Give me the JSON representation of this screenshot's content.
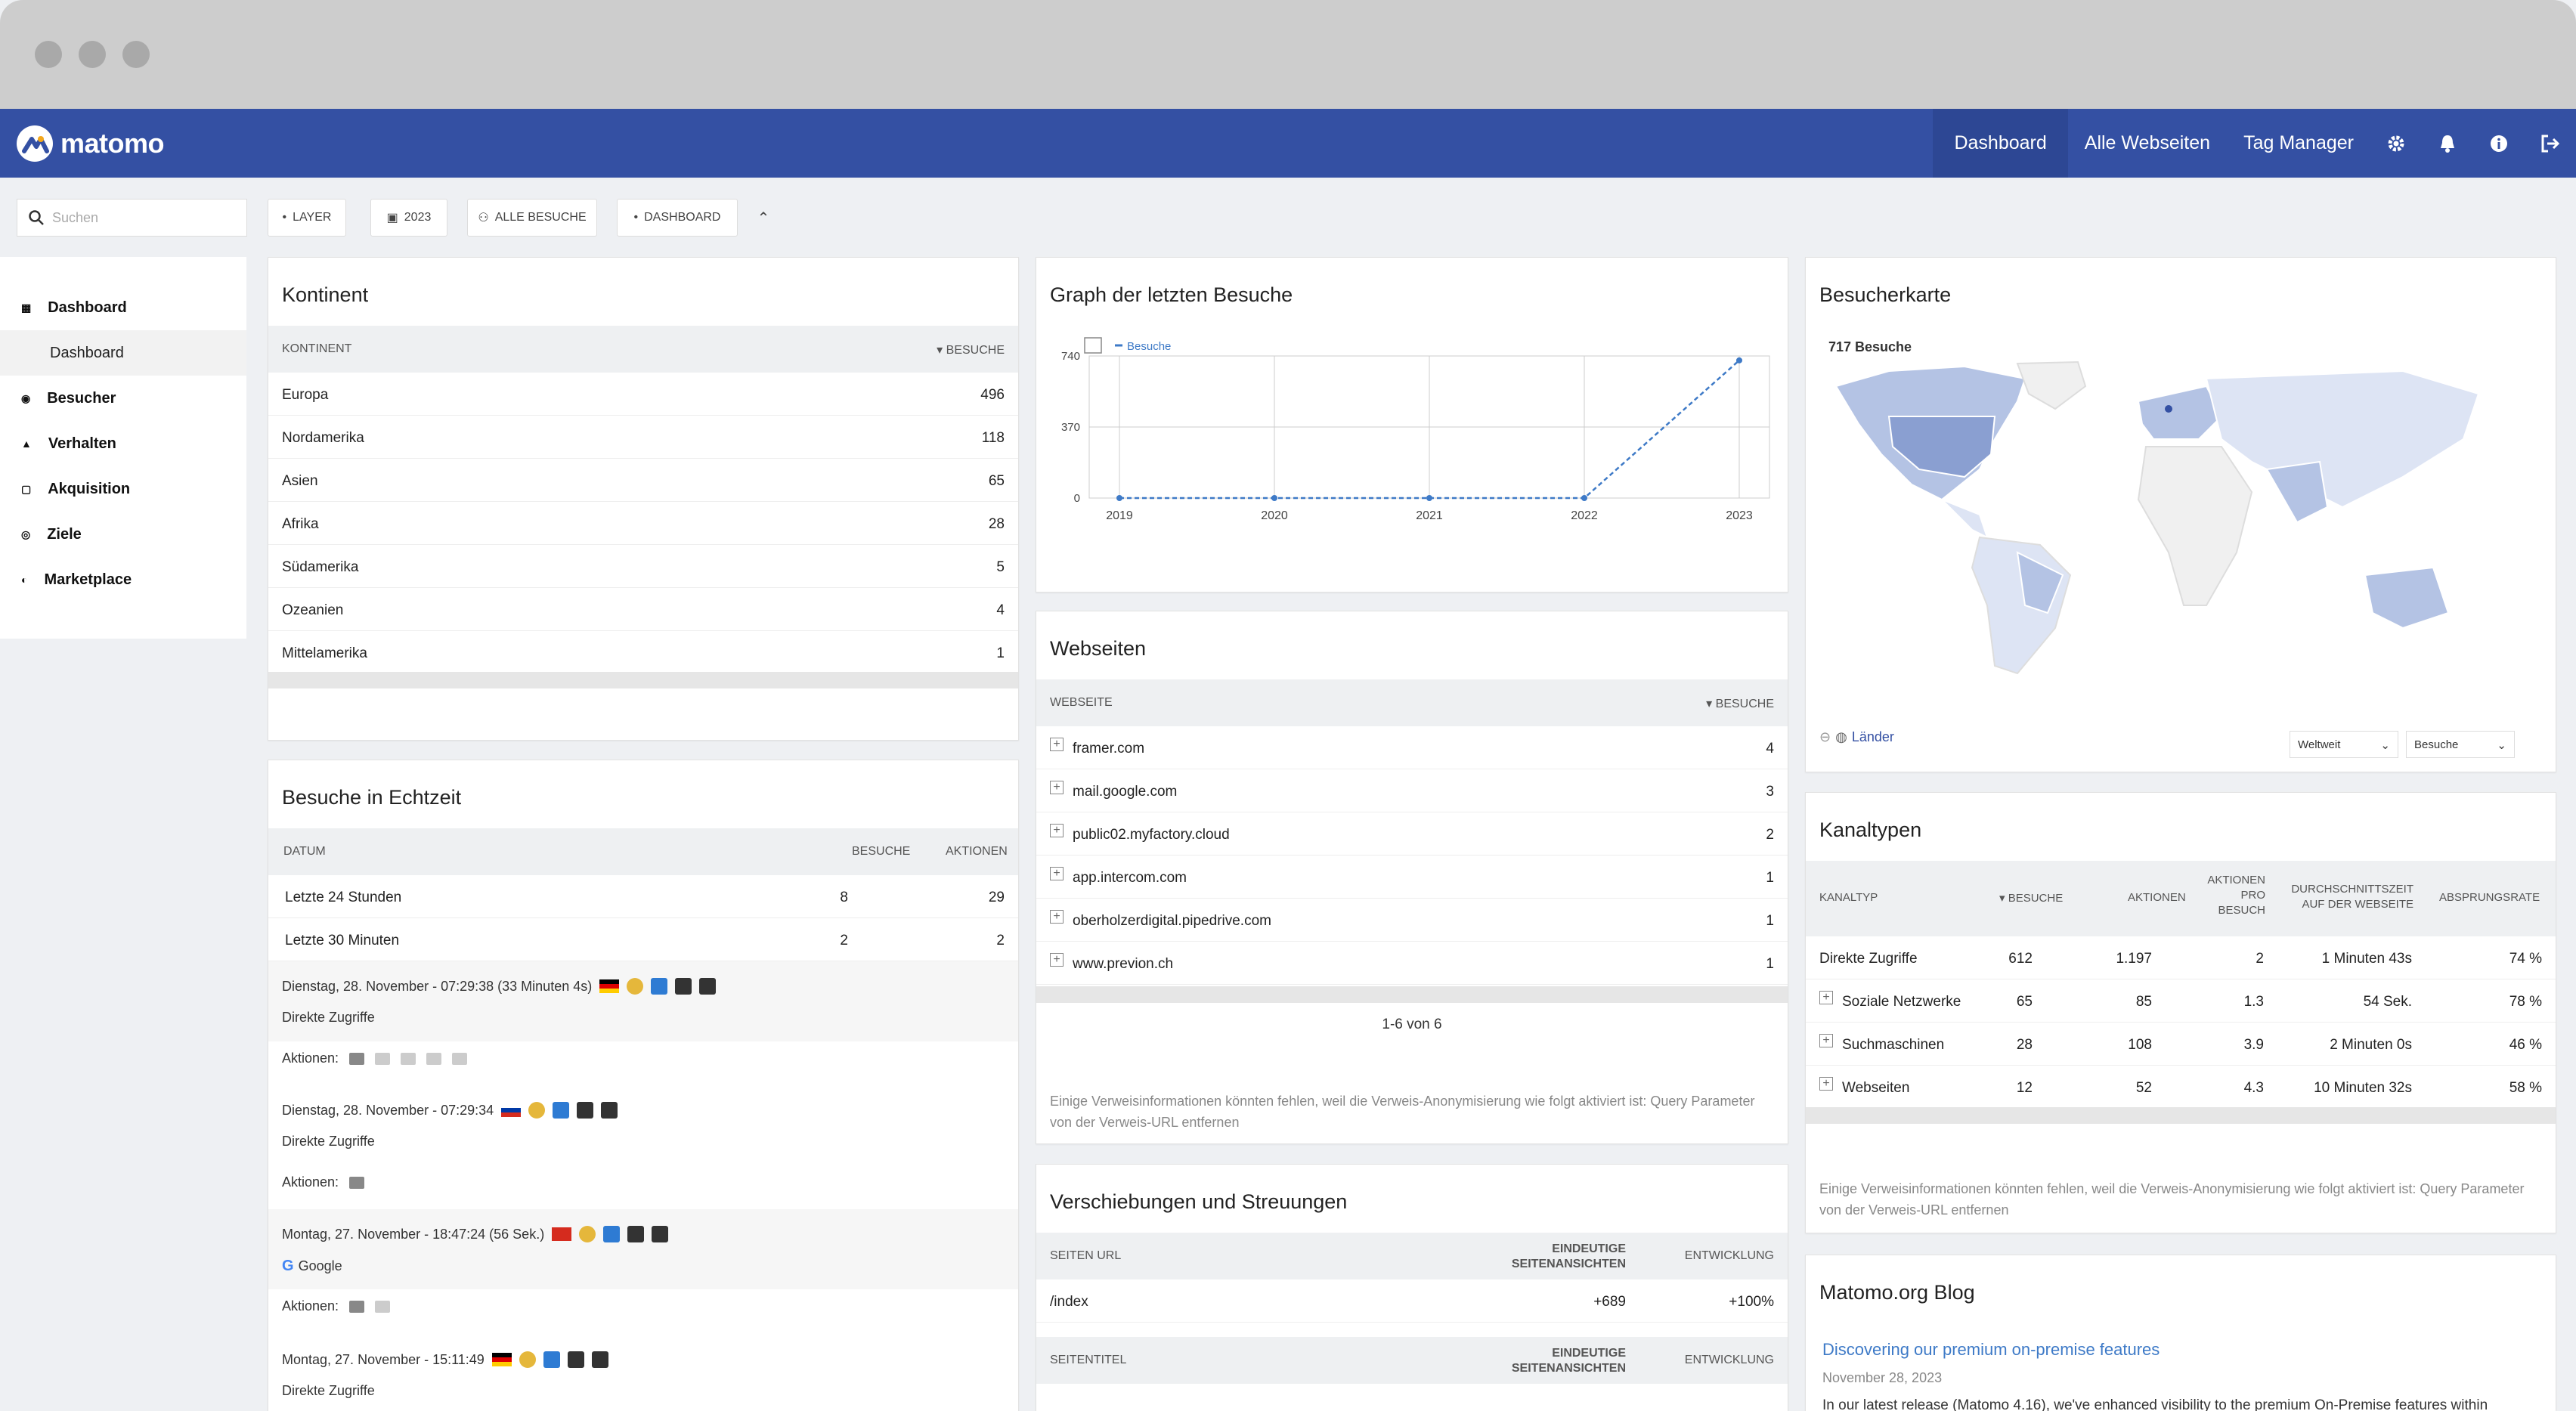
{
  "app": {
    "name": "matomo"
  },
  "nav": {
    "dashboard": "Dashboard",
    "all_sites": "Alle Webseiten",
    "tag_manager": "Tag Manager"
  },
  "toolbar": {
    "search_placeholder": "Suchen",
    "layer": "LAYER",
    "year": "2023",
    "segment": "ALLE BESUCHE",
    "dashboard": "DASHBOARD"
  },
  "sidebar": {
    "items": [
      {
        "label": "Dashboard",
        "icon": "grid-icon"
      },
      {
        "label": "Dashboard",
        "sub": true
      },
      {
        "label": "Besucher",
        "icon": "binoculars-icon"
      },
      {
        "label": "Verhalten",
        "icon": "bell-icon"
      },
      {
        "label": "Akquisition",
        "icon": "calendar-icon"
      },
      {
        "label": "Ziele",
        "icon": "target-icon"
      },
      {
        "label": "Marketplace",
        "icon": "headphones-icon"
      }
    ]
  },
  "continent": {
    "title": "Kontinent",
    "col1": "KONTINENT",
    "col2": "BESUCHE",
    "rows": [
      {
        "name": "Europa",
        "value": "496"
      },
      {
        "name": "Nordamerika",
        "value": "118"
      },
      {
        "name": "Asien",
        "value": "65"
      },
      {
        "name": "Afrika",
        "value": "28"
      },
      {
        "name": "Südamerika",
        "value": "5"
      },
      {
        "name": "Ozeanien",
        "value": "4"
      },
      {
        "name": "Mittelamerika",
        "value": "1"
      }
    ]
  },
  "realtime": {
    "title": "Besuche in Echtzeit",
    "col1": "DATUM",
    "col2": "BESUCHE",
    "col3": "AKTIONEN",
    "rows": [
      {
        "label": "Letzte 24 Stunden",
        "visits": "8",
        "actions": "29"
      },
      {
        "label": "Letzte 30 Minuten",
        "visits": "2",
        "actions": "2"
      }
    ],
    "actions_label": "Aktionen:",
    "visits": [
      {
        "time": "Dienstag, 28. November - 07:29:38 (33 Minuten 4s)",
        "source": "Direkte Zugriffe"
      },
      {
        "time": "Dienstag, 28. November - 07:29:34",
        "source": "Direkte Zugriffe"
      },
      {
        "time": "Montag, 27. November - 18:47:24 (56 Sek.)",
        "source": "Google"
      },
      {
        "time": "Montag, 27. November - 15:11:49",
        "source": "Direkte Zugriffe"
      }
    ]
  },
  "graph": {
    "title": "Graph der letzten Besuche"
  },
  "chart_data": {
    "type": "line",
    "categories": [
      "2019",
      "2020",
      "2021",
      "2022",
      "2023"
    ],
    "series": [
      {
        "name": "Besuche",
        "values": [
          0,
          0,
          0,
          0,
          717
        ]
      }
    ],
    "yticks": [
      "0",
      "370",
      "740"
    ],
    "ylim": [
      0,
      740
    ],
    "grid": true,
    "legend": "top-left"
  },
  "websites": {
    "title": "Webseiten",
    "col1": "WEBSEITE",
    "col2": "BESUCHE",
    "rows": [
      {
        "name": "framer.com",
        "value": "4"
      },
      {
        "name": "mail.google.com",
        "value": "3"
      },
      {
        "name": "public02.myfactory.cloud",
        "value": "2"
      },
      {
        "name": "app.intercom.com",
        "value": "1"
      },
      {
        "name": "oberholzerdigital.pipedrive.com",
        "value": "1"
      },
      {
        "name": "www.previon.ch",
        "value": "1"
      }
    ],
    "pagination": "1-6 von 6",
    "note": "Einige Verweisinformationen könnten fehlen, weil die Verweis-Anonymisierung wie folgt aktiviert ist: Query Parameter von der Verweis-URL entfernen"
  },
  "movers": {
    "title": "Verschiebungen und Streuungen",
    "col1": "SEITEN URL",
    "col2a": "EINDEUTIGE",
    "col2b": "SEITENANSICHTEN",
    "col3": "ENTWICKLUNG",
    "row": {
      "url": "/index",
      "views": "+689",
      "dev": "+100%"
    },
    "col1b": "SEITENTITEL"
  },
  "map": {
    "title": "Besucherkarte",
    "total": "717 Besuche",
    "countries": "Länder",
    "region": "Weltweit",
    "metric": "Besuche"
  },
  "channels": {
    "title": "Kanaltypen",
    "cols": [
      "KANALTYP",
      "BESUCHE",
      "AKTIONEN",
      "AKTIONEN PRO BESUCH",
      "DURCHSCHNITTSZEIT AUF DER WEBSEITE",
      "ABSPRUNGSRATE"
    ],
    "rows": [
      {
        "name": "Direkte Zugriffe",
        "v": "612",
        "a": "1.197",
        "apb": "2",
        "time": "1 Minuten 43s",
        "bounce": "74 %"
      },
      {
        "name": "Soziale Netzwerke",
        "v": "65",
        "a": "85",
        "apb": "1.3",
        "time": "54 Sek.",
        "bounce": "78 %"
      },
      {
        "name": "Suchmaschinen",
        "v": "28",
        "a": "108",
        "apb": "3.9",
        "time": "2 Minuten 0s",
        "bounce": "46 %"
      },
      {
        "name": "Webseiten",
        "v": "12",
        "a": "52",
        "apb": "4.3",
        "time": "10 Minuten 32s",
        "bounce": "58 %"
      }
    ],
    "note": "Einige Verweisinformationen könnten fehlen, weil die Verweis-Anonymisierung wie folgt aktiviert ist: Query Parameter von der Verweis-URL entfernen"
  },
  "blog": {
    "title": "Matomo.org Blog",
    "post_title": "Discovering our premium on-premise features",
    "date": "November 28, 2023",
    "excerpt": "In our latest release (Matomo 4.16), we've enhanced visibility to the premium On-Premise features within"
  }
}
